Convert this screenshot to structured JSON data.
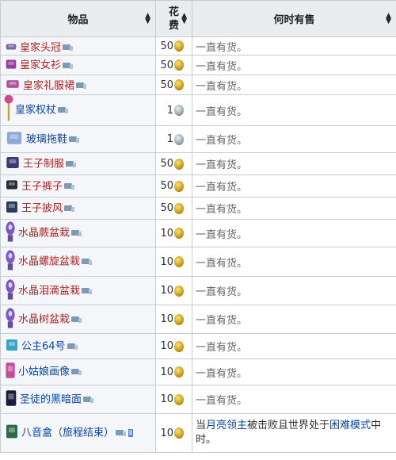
{
  "headers": {
    "item": "物品",
    "cost": "花费",
    "when": "何时有售"
  },
  "rows": [
    {
      "name": "皇家头冠",
      "cost": "50",
      "coin": "gold",
      "when": "一直有货。",
      "icon": "crown-icon",
      "iconColor": "#7a6a9a"
    },
    {
      "name": "皇家女衫",
      "cost": "50",
      "coin": "gold",
      "when": "一直有货。",
      "icon": "blouse-icon",
      "iconColor": "#9c3aa0"
    },
    {
      "name": "皇家礼服裙",
      "cost": "50",
      "coin": "gold",
      "when": "一直有货。",
      "icon": "gown-icon",
      "iconColor": "#b0559c"
    },
    {
      "name": "皇家权杖",
      "cost": "1",
      "coin": "platinum",
      "when": "一直有货。",
      "icon": "scepter-icon",
      "iconColor": "#d04a8a",
      "blue": true
    },
    {
      "name": "玻璃拖鞋",
      "cost": "1",
      "coin": "platinum",
      "when": "一直有货。",
      "icon": "slipper-icon",
      "iconColor": "#8fa8d8",
      "blue": true
    },
    {
      "name": "王子制服",
      "cost": "50",
      "coin": "gold",
      "when": "一直有货。",
      "icon": "uniform-icon",
      "iconColor": "#3a3a7a"
    },
    {
      "name": "王子裤子",
      "cost": "50",
      "coin": "gold",
      "when": "一直有货。",
      "icon": "pants-icon",
      "iconColor": "#2a2a3a"
    },
    {
      "name": "王子披风",
      "cost": "50",
      "coin": "gold",
      "when": "一直有货。",
      "icon": "cape-icon",
      "iconColor": "#2a3a5a"
    },
    {
      "name": "水晶蕨盆栽",
      "cost": "10",
      "coin": "gold",
      "when": "一直有货。",
      "icon": "crystal-fern-icon",
      "iconColor": "#7a5ac8"
    },
    {
      "name": "水晶螺旋盆栽",
      "cost": "10",
      "coin": "gold",
      "when": "一直有货。",
      "icon": "crystal-spiral-icon",
      "iconColor": "#7a5ac8"
    },
    {
      "name": "水晶泪滴盆栽",
      "cost": "10",
      "coin": "gold",
      "when": "一直有货。",
      "icon": "crystal-teardrop-icon",
      "iconColor": "#7a5ac8"
    },
    {
      "name": "水晶树盆栽",
      "cost": "10",
      "coin": "gold",
      "when": "一直有货。",
      "icon": "crystal-tree-icon",
      "iconColor": "#7a5ac8"
    },
    {
      "name": "公主64号",
      "cost": "10",
      "coin": "gold",
      "when": "一直有货。",
      "icon": "painting-icon",
      "iconColor": "#3aa0c8",
      "blue": true
    },
    {
      "name": "小姑娘画像",
      "cost": "10",
      "coin": "gold",
      "when": "一直有货。",
      "icon": "portrait-icon",
      "iconColor": "#c84a9a",
      "blue": true
    },
    {
      "name": "圣徒的黑暗面",
      "cost": "10",
      "coin": "gold",
      "when": "一直有货。",
      "icon": "dark-painting-icon",
      "iconColor": "#1a1a3a",
      "blue": true
    },
    {
      "name": "八音盒（旅程结束）",
      "cost": "10",
      "coin": "gold",
      "icon": "music-box-icon",
      "iconColor": "#2a6a4a",
      "blue": true,
      "whenParts": [
        "当",
        "月亮领主",
        "被击败且世界处于",
        "困难模式",
        "中时。"
      ]
    }
  ],
  "colors": {
    "header_bg": "#eaecf0",
    "border": "#c8ccd1",
    "red_link": "#b32424",
    "blue_link": "#0645ad"
  }
}
